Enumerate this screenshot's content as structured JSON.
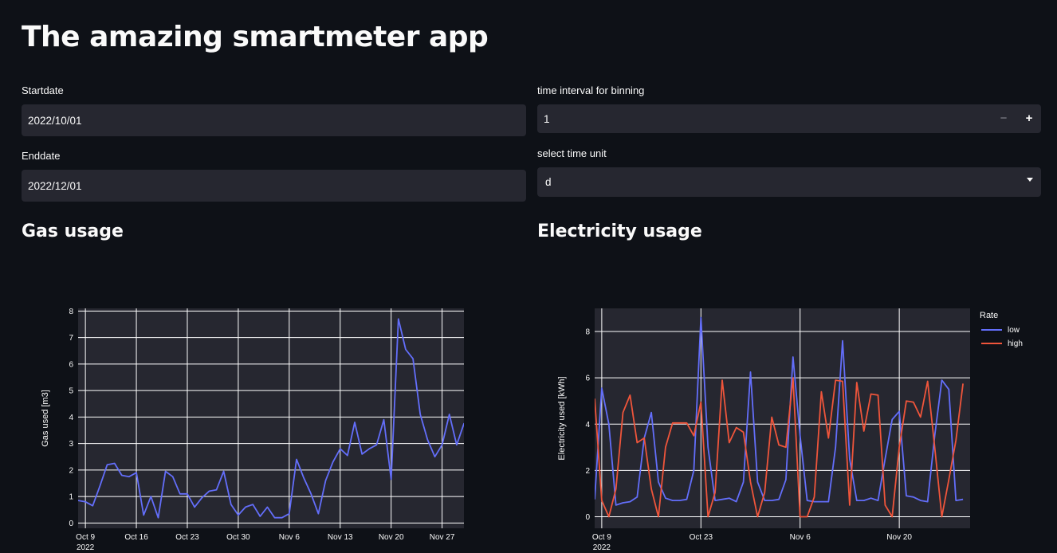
{
  "app": {
    "title": "The amazing smartmeter app"
  },
  "controls": {
    "startdate": {
      "label": "Startdate",
      "value": "2022/10/01"
    },
    "enddate": {
      "label": "Enddate",
      "value": "2022/12/01"
    },
    "interval": {
      "label": "time interval for binning",
      "value": "1",
      "minus": "−",
      "plus": "+"
    },
    "unit": {
      "label": "select time unit",
      "value": "d"
    }
  },
  "sections": {
    "gas": "Gas usage",
    "electricity": "Electricity usage"
  },
  "colors": {
    "low": "#636efa",
    "high": "#ef553b",
    "plot_bg": "#262730",
    "page_bg": "#0e1117",
    "grid": "#ffffff"
  },
  "chart_data": [
    {
      "id": "gas",
      "type": "line",
      "title": "",
      "xlabel": "",
      "ylabel": "Gas used [m3]",
      "x_start": "2022-10-08",
      "x_tick_labels": [
        "Oct 9",
        "Oct 16",
        "Oct 23",
        "Oct 30",
        "Nov 6",
        "Nov 13",
        "Nov 20",
        "Nov 27"
      ],
      "x_tick_days": [
        1,
        8,
        15,
        22,
        29,
        36,
        43,
        50
      ],
      "x_year_label": "2022",
      "y_ticks": [
        0,
        1,
        2,
        3,
        4,
        5,
        6,
        7,
        8
      ],
      "xlim": [
        0,
        53
      ],
      "ylim": [
        -0.2,
        8.1
      ],
      "grid": true,
      "series": [
        {
          "color": "#636efa",
          "values": [
            0.85,
            0.8,
            0.65,
            1.4,
            2.2,
            2.25,
            1.8,
            1.75,
            1.9,
            0.3,
            1.0,
            0.2,
            1.95,
            1.75,
            1.1,
            1.1,
            0.6,
            0.95,
            1.2,
            1.25,
            1.95,
            0.7,
            0.3,
            0.6,
            0.7,
            0.25,
            0.6,
            0.2,
            0.2,
            0.35,
            2.4,
            1.7,
            1.1,
            0.35,
            1.6,
            2.3,
            2.8,
            2.55,
            3.8,
            2.6,
            2.8,
            2.95,
            3.9,
            1.65,
            7.7,
            6.55,
            6.2,
            4.1,
            3.15,
            2.5,
            2.95,
            4.1,
            2.95,
            3.75,
            3.05
          ]
        }
      ]
    },
    {
      "id": "electricity",
      "type": "line",
      "title": "",
      "xlabel": "",
      "ylabel": "Electricity used [kWh]",
      "x_start": "2022-10-08",
      "x_tick_labels": [
        "Oct 9",
        "Oct 23",
        "Nov 6",
        "Nov 20"
      ],
      "x_tick_days": [
        1,
        15,
        29,
        43
      ],
      "x_year_label": "2022",
      "y_ticks": [
        0,
        2,
        4,
        6,
        8
      ],
      "xlim": [
        0,
        53
      ],
      "ylim": [
        -0.5,
        9.0
      ],
      "grid": true,
      "legend": {
        "title": "Rate",
        "position": "right"
      },
      "series": [
        {
          "name": "low",
          "color": "#636efa",
          "values": [
            0.75,
            5.55,
            4.0,
            0.5,
            0.6,
            0.65,
            0.85,
            3.4,
            4.5,
            1.5,
            0.8,
            0.7,
            0.7,
            0.75,
            2.0,
            8.6,
            3.0,
            0.7,
            0.75,
            0.8,
            0.65,
            1.5,
            6.25,
            1.5,
            0.7,
            0.7,
            0.75,
            1.6,
            6.9,
            3.5,
            0.7,
            0.65,
            0.65,
            0.65,
            3.0,
            7.6,
            2.5,
            0.7,
            0.7,
            0.8,
            0.7,
            2.5,
            4.2,
            4.55,
            0.9,
            0.85,
            0.7,
            0.65,
            3.5,
            5.9,
            5.5,
            0.7,
            0.75
          ]
        },
        {
          "name": "high",
          "color": "#ef553b",
          "values": [
            5.1,
            0.7,
            0.0,
            1.2,
            4.5,
            5.25,
            3.2,
            3.4,
            1.2,
            0.0,
            3.0,
            4.05,
            4.05,
            4.05,
            3.5,
            4.95,
            0.0,
            1.05,
            5.9,
            3.2,
            3.85,
            3.65,
            1.5,
            0.0,
            1.05,
            4.3,
            3.1,
            3.0,
            6.0,
            0.0,
            0.0,
            0.85,
            5.4,
            3.4,
            5.9,
            5.85,
            0.5,
            5.8,
            3.7,
            5.3,
            5.25,
            0.5,
            0.0,
            3.0,
            5.0,
            4.95,
            4.3,
            5.85,
            3.0,
            0.0,
            1.6,
            3.3,
            5.75
          ]
        }
      ]
    }
  ]
}
